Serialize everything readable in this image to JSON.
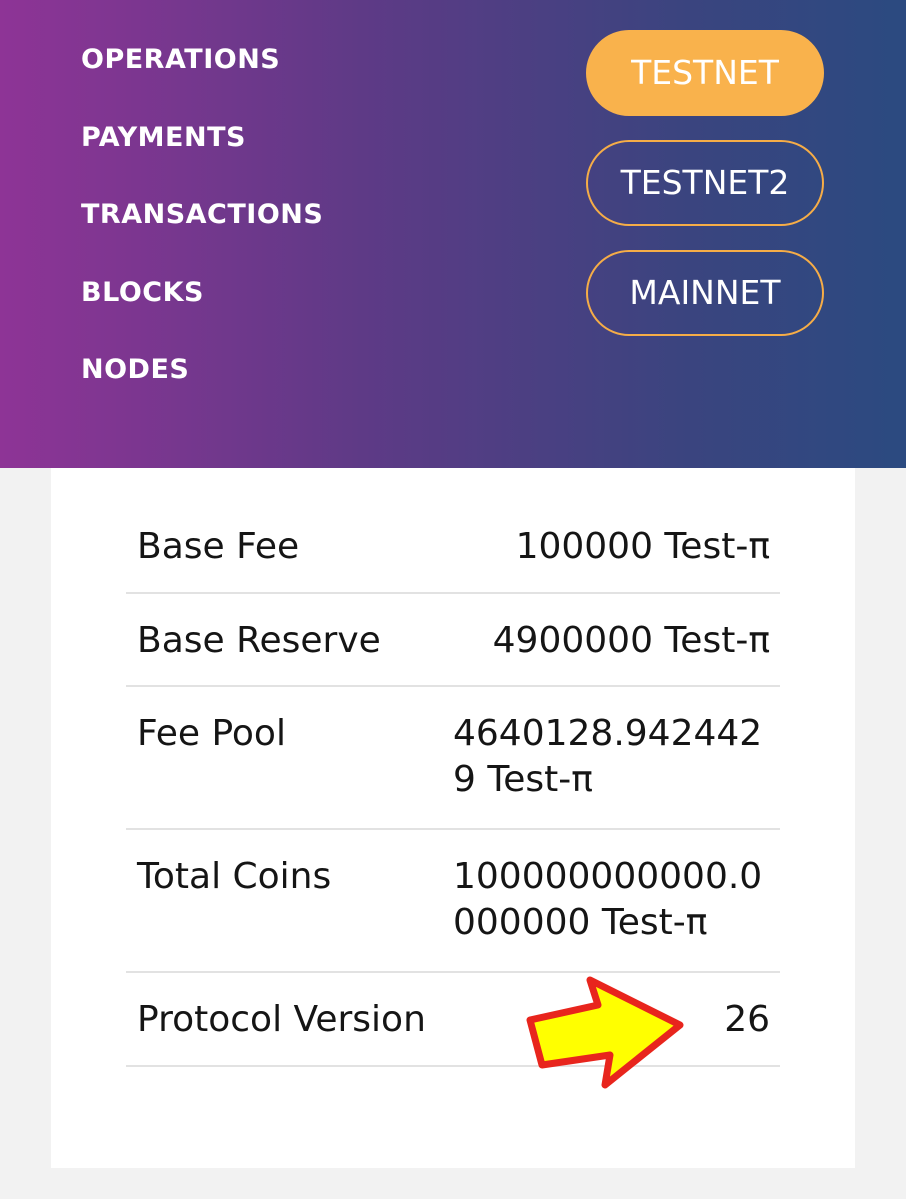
{
  "nav": {
    "items": [
      "OPERATIONS",
      "PAYMENTS",
      "TRANSACTIONS",
      "BLOCKS",
      "NODES"
    ]
  },
  "networks": {
    "items": [
      "TESTNET",
      "TESTNET2",
      "MAINNET"
    ],
    "active": "TESTNET"
  },
  "ledger": {
    "rows": [
      {
        "label": "Base Fee",
        "value": "100000 Test-π"
      },
      {
        "label": "Base Reserve",
        "value": "4900000 Test-π"
      },
      {
        "label": "Fee Pool",
        "value": "4640128.94244­29 Test-π"
      },
      {
        "label": "Total Coins",
        "value": "100000000000.­0000000 Test-π"
      },
      {
        "label": "Protocol Version",
        "value": "26"
      }
    ]
  },
  "annotation": {
    "arrow_color": "#ffff00",
    "arrow_outline": "#e8251d"
  },
  "colors": {
    "accent": "#f9b24c",
    "header_start": "#8e3496",
    "header_end": "#2b4a80"
  }
}
